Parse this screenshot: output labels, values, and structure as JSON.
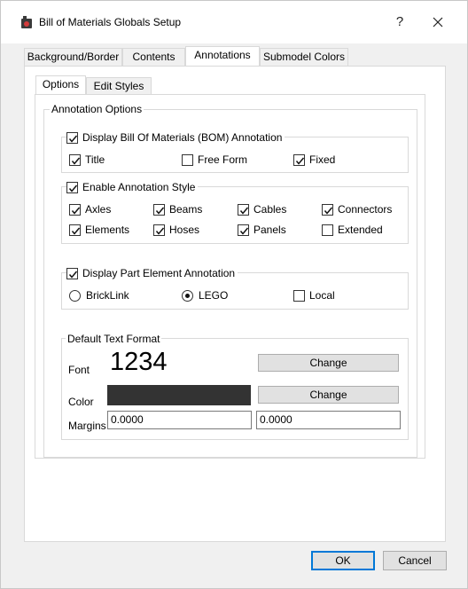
{
  "window": {
    "title": "Bill of Materials Globals Setup",
    "help_label": "?"
  },
  "tabs": [
    {
      "label": "Background/Border"
    },
    {
      "label": "Contents"
    },
    {
      "label": "Annotations"
    },
    {
      "label": "Submodel Colors"
    }
  ],
  "active_tab": "Annotations",
  "subtabs": [
    {
      "label": "Options"
    },
    {
      "label": "Edit Styles"
    }
  ],
  "active_subtab": "Options",
  "annotation_options": {
    "title": "Annotation Options",
    "bom_group": {
      "label": "Display Bill Of Materials (BOM) Annotation",
      "checked": true,
      "items": [
        {
          "label": "Title",
          "checked": true
        },
        {
          "label": "Free Form",
          "checked": false
        },
        {
          "label": "Fixed",
          "checked": true
        }
      ]
    },
    "style_group": {
      "label": "Enable Annotation Style",
      "checked": true,
      "items": [
        {
          "label": "Axles",
          "checked": true
        },
        {
          "label": "Beams",
          "checked": true
        },
        {
          "label": "Cables",
          "checked": true
        },
        {
          "label": "Connectors",
          "checked": true
        },
        {
          "label": "Elements",
          "checked": true
        },
        {
          "label": "Hoses",
          "checked": true
        },
        {
          "label": "Panels",
          "checked": true
        },
        {
          "label": "Extended",
          "checked": false
        }
      ]
    },
    "part_element_group": {
      "label": "Display Part Element Annotation",
      "checked": true,
      "radios": [
        {
          "label": "BrickLink",
          "selected": false
        },
        {
          "label": "LEGO",
          "selected": true
        }
      ],
      "local": {
        "label": "Local",
        "checked": false
      }
    },
    "text_format": {
      "title": "Default Text Format",
      "font_label": "Font",
      "font_sample": "1234",
      "font_change": "Change",
      "color_label": "Color",
      "color_value": "#333333",
      "color_change": "Change",
      "margins_label": "Margins",
      "margin_x": "0.0000",
      "margin_y": "0.0000"
    }
  },
  "footer": {
    "ok": "OK",
    "cancel": "Cancel"
  }
}
